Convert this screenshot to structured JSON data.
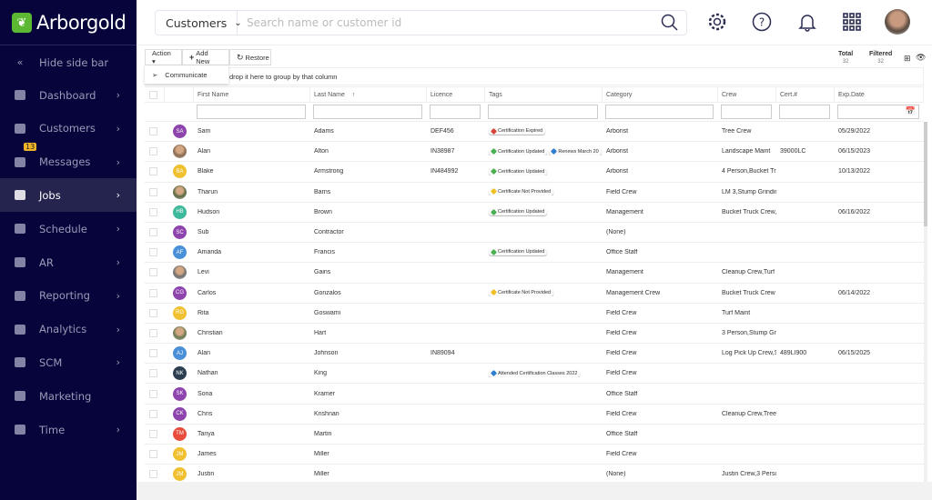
{
  "app": {
    "brand": "Arborgold",
    "accent": "#5cb832",
    "sidebar_bg": "#06043a"
  },
  "sidebar": {
    "hide_label": "Hide side bar",
    "items": [
      {
        "label": "Dashboard",
        "icon": "dashboard-icon",
        "chev": true
      },
      {
        "label": "Customers",
        "icon": "person-icon",
        "chev": true
      },
      {
        "label": "Messages",
        "icon": "message-icon",
        "chev": true,
        "badge": "13"
      },
      {
        "label": "Jobs",
        "icon": "briefcase-icon",
        "chev": true,
        "active": true
      },
      {
        "label": "Schedule",
        "icon": "calendar-icon",
        "chev": true
      },
      {
        "label": "AR",
        "icon": "hand-coin-icon",
        "chev": true
      },
      {
        "label": "Reporting",
        "icon": "report-icon",
        "chev": true
      },
      {
        "label": "Analytics",
        "icon": "bar-chart-icon",
        "chev": true
      },
      {
        "label": "SCM",
        "icon": "store-icon",
        "chev": true
      },
      {
        "label": "Marketing",
        "icon": "megaphone-icon",
        "chev": false
      },
      {
        "label": "Time",
        "icon": "clock-icon",
        "chev": true
      }
    ]
  },
  "header": {
    "search_scope": "Customers",
    "search_placeholder": "Search name or customer id"
  },
  "toolbar": {
    "action": "Action ▾",
    "add_new": "Add New",
    "restore": "Restore",
    "menu_item": "Communicate",
    "group_hint": "drop it here to group by that column",
    "total_label": "Total",
    "total": "32",
    "filtered_label": "Filtered",
    "filtered": "32"
  },
  "columns": [
    "First Name",
    "Last Name",
    "Licence",
    "Tags",
    "Category",
    "Crew",
    "Cert.#",
    "Exp.Date"
  ],
  "tag_colors": {
    "red": "#d9443a",
    "green": "#4cb050",
    "blue": "#2f7fd0",
    "yellow": "#f0c020"
  },
  "rows": [
    {
      "initials": "SA",
      "color": "#8e44ad",
      "first": "Sam",
      "last": "Adams",
      "licence": "DEF456",
      "tags": [
        {
          "t": "Certification Expired",
          "c": "red"
        }
      ],
      "category": "Arborist",
      "crew": "Tree Crew",
      "cert": "",
      "exp": "05/29/2022"
    },
    {
      "photo": true,
      "color": "#8a6a50",
      "first": "Alan",
      "last": "Alton",
      "licence": "IN38987",
      "tags": [
        {
          "t": "Certification Updated",
          "c": "green"
        },
        {
          "t": "Renews March 20",
          "c": "blue"
        }
      ],
      "category": "Arborist",
      "crew": "Landscape Maint",
      "cert": "39000LC",
      "exp": "06/15/2023"
    },
    {
      "initials": "BA",
      "color": "#f0c030",
      "first": "Blake",
      "last": "Armstrong",
      "licence": "IN484992",
      "tags": [
        {
          "t": "Certification Updated",
          "c": "green"
        }
      ],
      "category": "Arborist",
      "crew": "4 Person,Bucket Tr.",
      "cert": "",
      "exp": "10/13/2022"
    },
    {
      "photo": true,
      "color": "#5a6a40",
      "first": "Tharun",
      "last": "Barns",
      "licence": "",
      "tags": [
        {
          "t": "Certificate Not Provided",
          "c": "yellow"
        }
      ],
      "category": "Field Crew",
      "crew": "LM 3,Stump Grindir",
      "cert": "",
      "exp": ""
    },
    {
      "initials": "HB",
      "color": "#3cb89a",
      "first": "Hudson",
      "last": "Brown",
      "licence": "",
      "tags": [
        {
          "t": "Certification Updated",
          "c": "green"
        }
      ],
      "category": "Management",
      "crew": "Bucket Truck Crew,I",
      "cert": "",
      "exp": "06/16/2022"
    },
    {
      "initials": "SC",
      "color": "#8e44ad",
      "first": "Sub",
      "last": "Contractor",
      "licence": "",
      "tags": [],
      "category": "(None)",
      "crew": "",
      "cert": "",
      "exp": ""
    },
    {
      "initials": "AF",
      "color": "#4a90d9",
      "first": "Amanda",
      "last": "Francis",
      "licence": "",
      "tags": [
        {
          "t": "Certification Updated",
          "c": "green"
        }
      ],
      "category": "Office Staff",
      "crew": "",
      "cert": "",
      "exp": ""
    },
    {
      "photo": true,
      "color": "#707070",
      "first": "Levi",
      "last": "Gains",
      "licence": "",
      "tags": [],
      "category": "Management",
      "crew": "Cleanup Crew,Turf I",
      "cert": "",
      "exp": ""
    },
    {
      "initials": "CG",
      "color": "#8e44ad",
      "first": "Carlos",
      "last": "Gonzalos",
      "licence": "",
      "tags": [
        {
          "t": "Certificate Not Provided",
          "c": "yellow"
        }
      ],
      "category": "Management Crew",
      "crew": "Bucket Truck Crew",
      "cert": "",
      "exp": "06/14/2022"
    },
    {
      "initials": "RG",
      "color": "#f0c030",
      "first": "Rita",
      "last": "Goswami",
      "licence": "",
      "tags": [],
      "category": "Field Crew",
      "crew": "Turf Maint",
      "cert": "",
      "exp": ""
    },
    {
      "photo": true,
      "color": "#6a7a50",
      "first": "Christian",
      "last": "Hart",
      "licence": "",
      "tags": [],
      "category": "Field Crew",
      "crew": "3 Person,Stump Gri",
      "cert": "",
      "exp": ""
    },
    {
      "initials": "AJ",
      "color": "#4a90d9",
      "first": "Alan",
      "last": "Johnson",
      "licence": "IN89094",
      "tags": [],
      "category": "Field Crew",
      "crew": "Log Pick Up Crew,S",
      "cert": "489LI900",
      "exp": "06/15/2025"
    },
    {
      "initials": "NK",
      "color": "#2c3e50",
      "first": "Nathan",
      "last": "King",
      "licence": "",
      "tags": [
        {
          "t": "Attended Certification Classes 2022",
          "c": "blue"
        }
      ],
      "category": "Field Crew",
      "crew": "",
      "cert": "",
      "exp": ""
    },
    {
      "initials": "SK",
      "color": "#8e44ad",
      "first": "Sona",
      "last": "Kramer",
      "licence": "",
      "tags": [],
      "category": "Office Staff",
      "crew": "",
      "cert": "",
      "exp": ""
    },
    {
      "initials": "CK",
      "color": "#8e44ad",
      "first": "Chris",
      "last": "Krishnan",
      "licence": "",
      "tags": [],
      "category": "Field Crew",
      "crew": "Cleanup Crew,Tree",
      "cert": "",
      "exp": ""
    },
    {
      "initials": "TM",
      "color": "#e74c3c",
      "first": "Tanya",
      "last": "Martin",
      "licence": "",
      "tags": [],
      "category": "Office Staff",
      "crew": "",
      "cert": "",
      "exp": ""
    },
    {
      "initials": "JM",
      "color": "#f0c030",
      "first": "James",
      "last": "Miller",
      "licence": "",
      "tags": [],
      "category": "Field Crew",
      "crew": "",
      "cert": "",
      "exp": ""
    },
    {
      "initials": "JM",
      "color": "#f0c030",
      "first": "Justin",
      "last": "Miller",
      "licence": "",
      "tags": [],
      "category": "(None)",
      "crew": "Justin Crew,3 Perso",
      "cert": "",
      "exp": ""
    }
  ]
}
